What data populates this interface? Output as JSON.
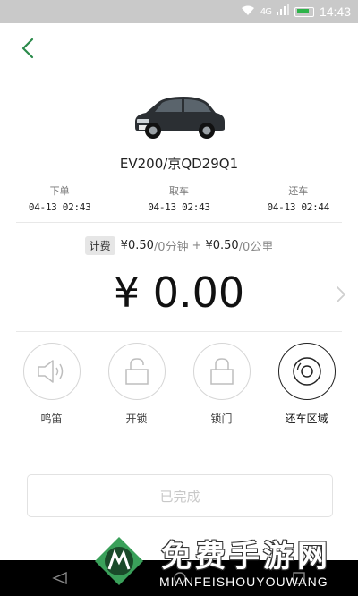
{
  "status_bar": {
    "time": "14:43",
    "network": "4G",
    "battery_color": "#2db34a"
  },
  "car": {
    "title": "EV200/京QD29Q1"
  },
  "times": [
    {
      "label": "下单",
      "value": "04-13 02:43"
    },
    {
      "label": "取车",
      "value": "04-13 02:43"
    },
    {
      "label": "还车",
      "value": "04-13 02:44"
    }
  ],
  "fee": {
    "badge": "计费",
    "time_price": "¥0.50",
    "time_unit": "/0分钟",
    "plus": "+",
    "distance_price": "¥0.50",
    "distance_unit": "/0公里"
  },
  "amount": "¥ 0.00",
  "actions": [
    {
      "label": "鸣笛",
      "icon": "speaker-icon"
    },
    {
      "label": "开锁",
      "icon": "unlock-icon"
    },
    {
      "label": "锁门",
      "icon": "lock-icon"
    },
    {
      "label": "还车区域",
      "icon": "target-icon"
    }
  ],
  "done_button": "已完成",
  "watermark": {
    "title": "免费手游网",
    "subtitle": "MIANFEISHOUYOUWANG"
  },
  "colors": {
    "accent": "#2a8a4a",
    "watermark_green": "#3aa05a"
  }
}
